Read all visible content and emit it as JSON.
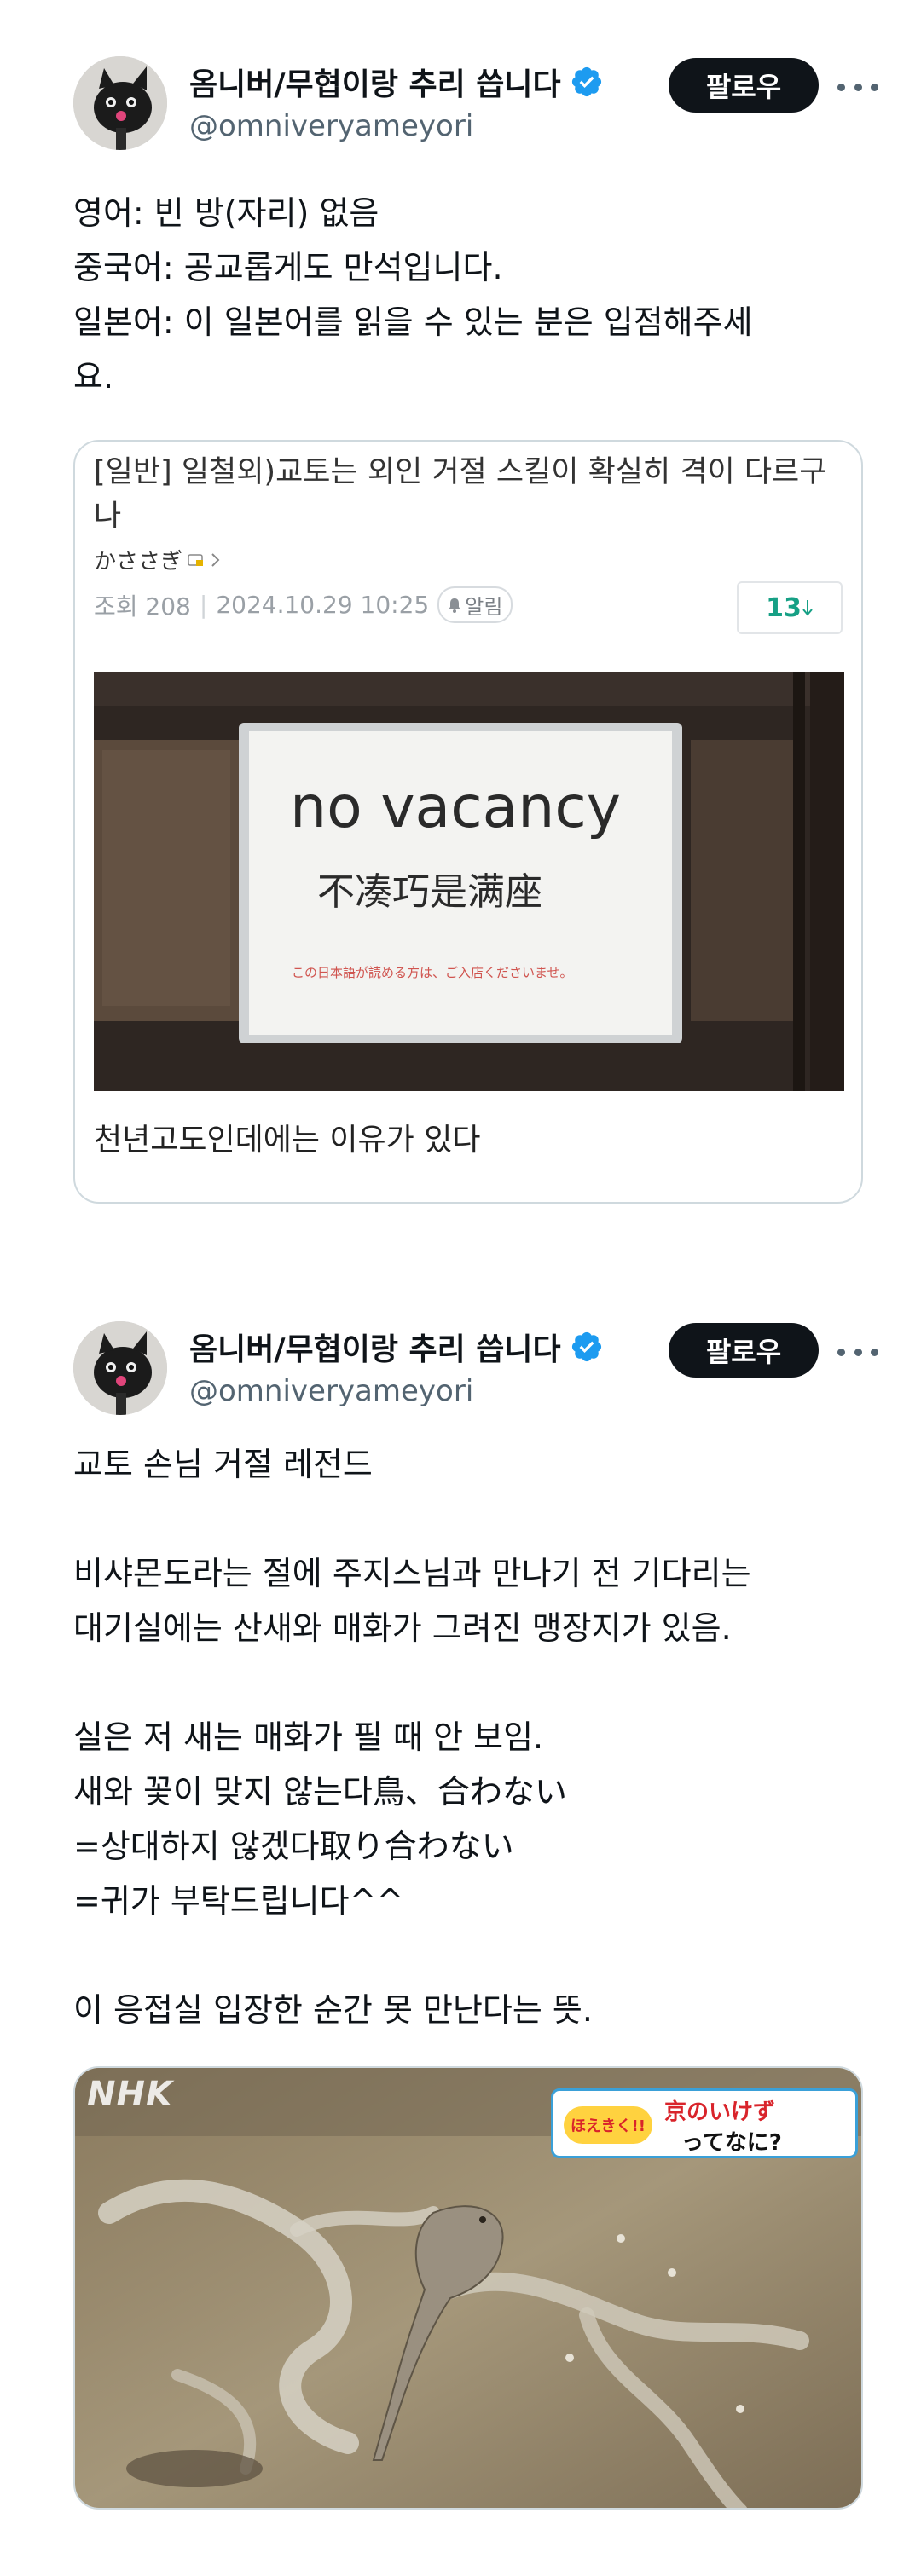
{
  "tweets": [
    {
      "author": {
        "display_name": "옴니버/무협이랑 추리 씁니다",
        "handle": "@omniveryameyori"
      },
      "follow_label": "팔로우",
      "text_lines": [
        "영어: 빈 방(자리) 없음",
        "중국어: 공교롭게도 만석입니다.",
        "일본어: 이 일본어를 읽을 수 있는 분은 입점해주세",
        "요."
      ],
      "quote": {
        "post_title": "[일반] 일철외)교토는 외인 거절 스킬이 확실히 격이 다르구나",
        "post_author": "かささぎ",
        "views": "조회 208",
        "datetime": "2024.10.29 10:25",
        "alarm_label": "알림",
        "comment_count": "13",
        "sign": {
          "english": "no vacancy",
          "chinese": "不凑巧是满座",
          "japanese": "この日本語が読める方は、ご入店くださいませ。"
        },
        "caption": "천년고도인데에는 이유가 있다"
      }
    },
    {
      "author": {
        "display_name": "옴니버/무협이랑 추리 씁니다",
        "handle": "@omniveryameyori"
      },
      "follow_label": "팔로우",
      "text_lines": [
        "교토 손님 거절 레전드",
        "",
        "비샤몬도라는 절에 주지스님과 만나기 전 기다리는",
        "대기실에는 산새와 매화가 그려진 맹장지가 있음.",
        "",
        "실은 저 새는 매화가 필 때 안 보임.",
        "새와 꽃이 맞지 않는다鳥、合わない",
        "=상대하지 않겠다取り合わない",
        "=귀가 부탁드립니다^^",
        "",
        "이 응접실 입장한 순간 못 만난다는 뜻."
      ],
      "media": {
        "watermark": "NHK",
        "tv_logo": "ほえきく!!",
        "tv_title": "京のいけず",
        "tv_subtitle": "ってなに?"
      }
    }
  ],
  "icons": {
    "verified": "verified-badge-icon",
    "more": "more-options-icon",
    "alarm": "bell-icon"
  },
  "colors": {
    "verified": "#1d9bf0",
    "follow_bg": "#0f1419",
    "comment_count": "#16a085",
    "secondary_text": "#536471"
  }
}
